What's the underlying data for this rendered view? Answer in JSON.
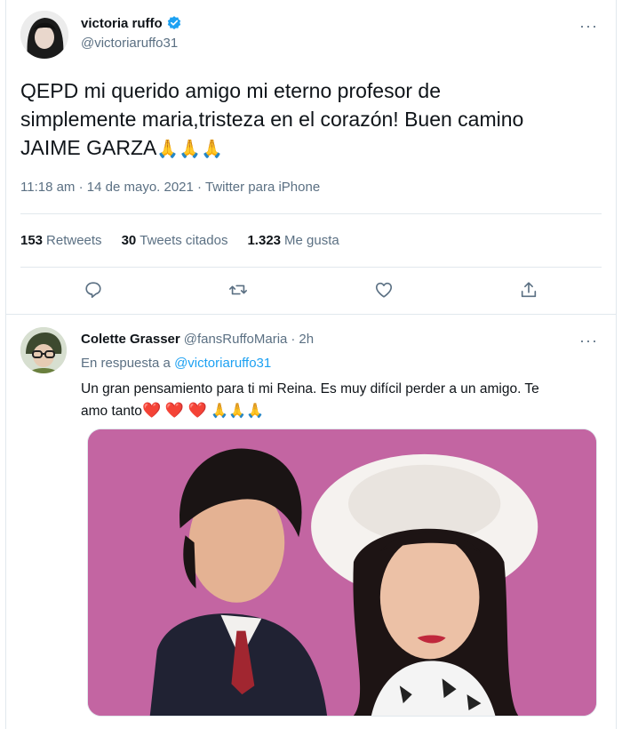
{
  "main_tweet": {
    "display_name": "victoria ruffo",
    "handle": "@victoriaruffo31",
    "text_line1": "QEPD  mi querido amigo mi eterno profesor de",
    "text_line2": "simplemente maria,tristeza en el corazón! Buen camino",
    "text_line3": "JAIME GARZA",
    "emoji": "🙏🙏🙏",
    "time": "11:18 am",
    "date": "14 de mayo. 2021",
    "source": "Twitter para iPhone",
    "stats": {
      "retweets_count": "153",
      "retweets_label": "Retweets",
      "quotes_count": "30",
      "quotes_label": "Tweets citados",
      "likes_count": "1.323",
      "likes_label": "Me gusta"
    },
    "icons": {
      "reply": "reply-icon",
      "retweet": "retweet-icon",
      "like": "heart-icon",
      "share": "share-icon"
    }
  },
  "reply": {
    "display_name": "Colette Grasser",
    "handle": "@fansRuffoMaria",
    "separator": "·",
    "time": "2h",
    "replying_to_label": "En respuesta a",
    "replying_to_handle": "@victoriaruffo31",
    "text_line1": "Un gran pensamiento para ti mi Reina. Es muy difícil perder a un amigo. Te",
    "text_line2": "amo tanto",
    "hearts": "❤️ ❤️ ❤️",
    "pray": "🙏🙏🙏"
  },
  "more_glyph": "···",
  "colors": {
    "text": "#0f1419",
    "secondary": "#5b7083",
    "link": "#1da1f2",
    "border": "#e1e8ed",
    "verified": "#1da1f2",
    "photo_bg": "#c96aa6"
  }
}
